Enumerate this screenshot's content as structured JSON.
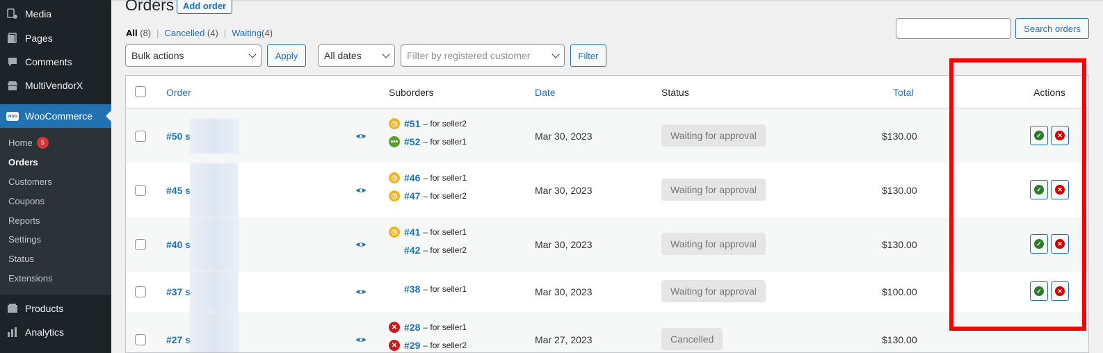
{
  "sidebar": {
    "items": [
      {
        "label": "Media",
        "icon": "media-icon"
      },
      {
        "label": "Pages",
        "icon": "pages-icon"
      },
      {
        "label": "Comments",
        "icon": "comments-icon"
      },
      {
        "label": "MultiVendorX",
        "icon": "multivendorx-icon"
      },
      {
        "label": "WooCommerce",
        "icon": "woocommerce-icon",
        "logo": "woo"
      },
      {
        "label": "Products",
        "icon": "products-icon"
      },
      {
        "label": "Analytics",
        "icon": "analytics-icon"
      }
    ],
    "submenu": [
      {
        "label": "Home",
        "badge": "5"
      },
      {
        "label": "Orders"
      },
      {
        "label": "Customers"
      },
      {
        "label": "Coupons"
      },
      {
        "label": "Reports"
      },
      {
        "label": "Settings"
      },
      {
        "label": "Status"
      },
      {
        "label": "Extensions"
      }
    ]
  },
  "header": {
    "title": "Orders",
    "add_label": "Add order"
  },
  "views": {
    "all": {
      "label": "All",
      "count": "(8)"
    },
    "cancelled": {
      "label": "Cancelled",
      "count": "(4)"
    },
    "waiting": {
      "label": "Waiting",
      "count": "(4)"
    },
    "separator": "|"
  },
  "search": {
    "button": "Search orders",
    "value": ""
  },
  "filters": {
    "bulk_actions": "Bulk actions",
    "apply": "Apply",
    "dates": "All dates",
    "customer_placeholder": "Filter by registered customer",
    "filter": "Filter"
  },
  "table": {
    "columns": {
      "order": "Order",
      "suborders": "Suborders",
      "date": "Date",
      "status": "Status",
      "total": "Total",
      "actions": "Actions"
    },
    "rows": [
      {
        "order": "#50 s",
        "date": "Mar 30, 2023",
        "status": "Waiting for approval",
        "total": "$130.00",
        "suborders": [
          {
            "num": "#51",
            "for": "– for seller2",
            "icon": "clock"
          },
          {
            "num": "#52",
            "for": "– for seller1",
            "icon": "processing"
          }
        ]
      },
      {
        "order": "#45 s",
        "date": "Mar 30, 2023",
        "status": "Waiting for approval",
        "total": "$130.00",
        "suborders": [
          {
            "num": "#46",
            "for": "– for seller1",
            "icon": "clock"
          },
          {
            "num": "#47",
            "for": "– for seller2",
            "icon": "clock"
          }
        ]
      },
      {
        "order": "#40 s",
        "date": "Mar 30, 2023",
        "status": "Waiting for approval",
        "total": "$130.00",
        "suborders": [
          {
            "num": "#41",
            "for": "– for seller1",
            "icon": "clock"
          },
          {
            "num": "#42",
            "for": "– for seller2",
            "icon": "none"
          }
        ]
      },
      {
        "order": "#37 s",
        "date": "Mar 30, 2023",
        "status": "Waiting for approval",
        "total": "$100.00",
        "suborders": [
          {
            "num": "#38",
            "for": "– for seller1",
            "icon": "none"
          }
        ]
      },
      {
        "order": "#27 s",
        "date": "Mar 27, 2023",
        "status": "Cancelled",
        "total": "$130.00",
        "suborders": [
          {
            "num": "#28",
            "for": "– for seller1",
            "icon": "cancel"
          },
          {
            "num": "#29",
            "for": "– for seller2",
            "icon": "cancel"
          }
        ]
      }
    ]
  },
  "colors": {
    "accent": "#2271b1",
    "sidebar_bg": "#1d2327",
    "highlight": "#ff0000",
    "approve": "#2a7e2a",
    "reject": "#d40000"
  }
}
